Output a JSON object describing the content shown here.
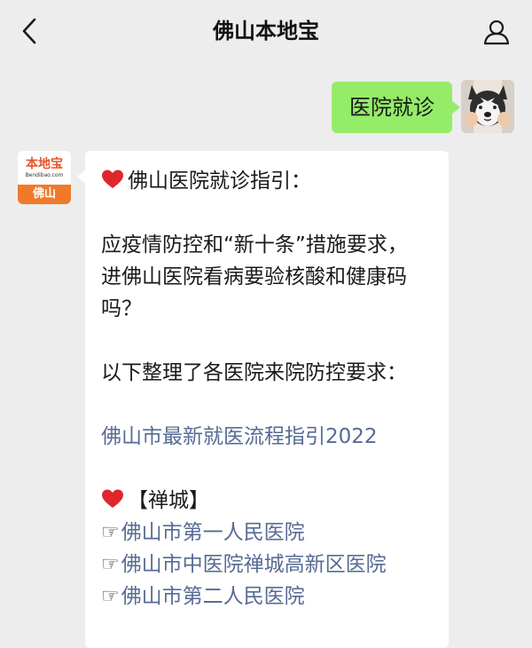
{
  "header": {
    "title": "佛山本地宝",
    "back_icon": "chevron-left-icon",
    "profile_icon": "person-icon"
  },
  "outgoing": {
    "text": "医院就诊",
    "bubble_color": "#95ec69"
  },
  "bot": {
    "avatar": {
      "logo_name": "本地宝",
      "logo_sub": "Bendibao.com",
      "logo_city": "佛山"
    },
    "message": {
      "heading": "佛山医院就诊指引：",
      "intro": [
        "应疫情防控和“新十条”措施要求，",
        "进佛山医院看病要验核酸和健康码",
        "吗？"
      ],
      "summary": "以下整理了各医院来院防控要求：",
      "guide_link": "佛山市最新就医流程指引2022",
      "section_title": "【禅城】",
      "hospital_links": [
        "佛山市第一人民医院",
        "佛山市中医院禅城高新区医院",
        "佛山市第二人民医院"
      ],
      "pointer_glyph": "☞",
      "link_color": "#576b95",
      "heart_color": "#e0262b"
    }
  }
}
